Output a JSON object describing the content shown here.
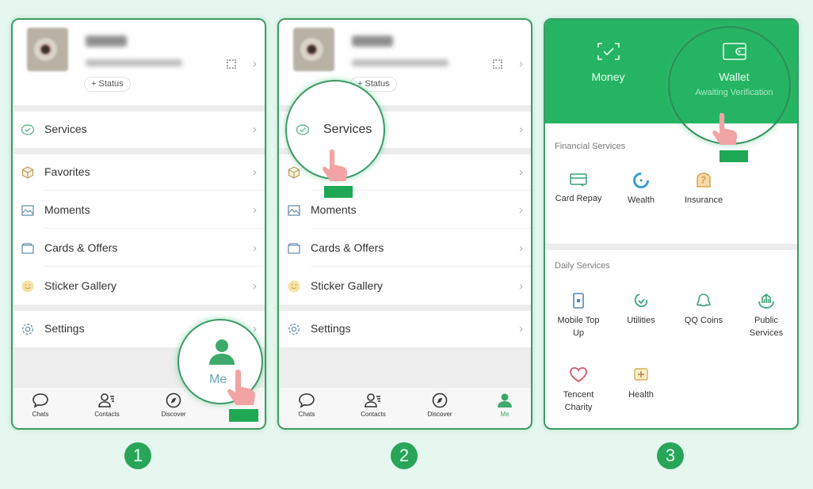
{
  "colors": {
    "brand_green": "#25b463",
    "outline_green": "#3f9a68",
    "background": "#e6f7ef",
    "hand_pink": "#f2a3a3"
  },
  "profile": {
    "status_button": "+ Status"
  },
  "me_menu": {
    "items": [
      {
        "label": "Services",
        "icon": "services-icon"
      },
      {
        "label": "Favorites",
        "icon": "favorites-cube-icon"
      },
      {
        "label": "Moments",
        "icon": "moments-image-icon"
      },
      {
        "label": "Cards & Offers",
        "icon": "cards-folder-icon"
      },
      {
        "label": "Sticker Gallery",
        "icon": "sticker-smiley-icon"
      },
      {
        "label": "Settings",
        "icon": "gear-icon"
      }
    ]
  },
  "tabbar": {
    "tabs": [
      {
        "label": "Chats",
        "icon": "chat-bubble-icon"
      },
      {
        "label": "Contacts",
        "icon": "contacts-icon"
      },
      {
        "label": "Discover",
        "icon": "compass-icon"
      },
      {
        "label": "Me",
        "icon": "person-icon"
      }
    ]
  },
  "callouts": {
    "step1": "Me",
    "step2": "Services"
  },
  "services_page": {
    "money": {
      "label": "Money"
    },
    "wallet": {
      "label": "Wallet",
      "status": "Awaiting Verification"
    },
    "financial": {
      "title": "Financial Services",
      "items": [
        {
          "label": "Card Repay",
          "icon": "card-repay-icon"
        },
        {
          "label": "Wealth",
          "icon": "wealth-icon"
        },
        {
          "label": "Insurance",
          "icon": "insurance-icon"
        }
      ]
    },
    "daily": {
      "title": "Daily Services",
      "items": [
        {
          "label": "Mobile Top Up",
          "icon": "mobile-topup-icon"
        },
        {
          "label": "Utilities",
          "icon": "utilities-icon"
        },
        {
          "label": "QQ Coins",
          "icon": "qq-coins-icon"
        },
        {
          "label": "Public Services",
          "icon": "public-services-icon"
        },
        {
          "label": "Tencent Charity",
          "icon": "charity-heart-icon"
        },
        {
          "label": "Health",
          "icon": "health-icon"
        }
      ]
    }
  },
  "steps": [
    "1",
    "2",
    "3"
  ]
}
